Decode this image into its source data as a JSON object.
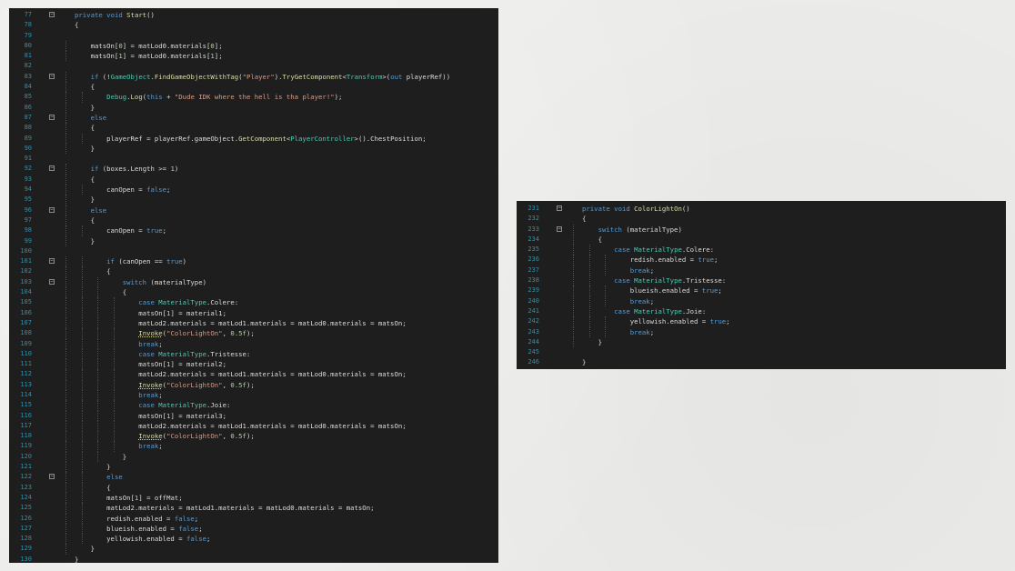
{
  "left_editor": {
    "lines": [
      {
        "n": "77",
        "code": "private void Start()",
        "fold": true
      },
      {
        "n": "78",
        "code": "{"
      },
      {
        "n": "79",
        "code": ""
      },
      {
        "n": "80",
        "code": "    matsOn[0] = matLod0.materials[0];"
      },
      {
        "n": "81",
        "code": "    matsOn[1] = matLod0.materials[1];"
      },
      {
        "n": "82",
        "code": ""
      },
      {
        "n": "83",
        "code": "    if (!GameObject.FindGameObjectWithTag(\"Player\").TryGetComponent<Transform>(out playerRef))",
        "fold": true
      },
      {
        "n": "84",
        "code": "    {"
      },
      {
        "n": "85",
        "code": "        Debug.Log(this + \"Dude IDK where the hell is tha player!\");"
      },
      {
        "n": "86",
        "code": "    }"
      },
      {
        "n": "87",
        "code": "    else",
        "fold": true
      },
      {
        "n": "88",
        "code": "    {"
      },
      {
        "n": "89",
        "code": "        playerRef = playerRef.gameObject.GetComponent<PlayerController>().ChestPosition;"
      },
      {
        "n": "90",
        "code": "    }"
      },
      {
        "n": "91",
        "code": ""
      },
      {
        "n": "92",
        "code": "    if (boxes.Length >= 1)",
        "fold": true
      },
      {
        "n": "93",
        "code": "    {"
      },
      {
        "n": "94",
        "code": "        canOpen = false;"
      },
      {
        "n": "95",
        "code": "    }"
      },
      {
        "n": "96",
        "code": "    else",
        "fold": true
      },
      {
        "n": "97",
        "code": "    {"
      },
      {
        "n": "98",
        "code": "        canOpen = true;"
      },
      {
        "n": "99",
        "code": "    }"
      },
      {
        "n": "100",
        "code": ""
      },
      {
        "n": "101",
        "code": "        if (canOpen == true)",
        "fold": true
      },
      {
        "n": "102",
        "code": "        {"
      },
      {
        "n": "103",
        "code": "            switch (materialType)",
        "fold": true
      },
      {
        "n": "104",
        "code": "            {"
      },
      {
        "n": "105",
        "code": "                case MaterialType.Colere:"
      },
      {
        "n": "106",
        "code": "                matsOn[1] = material1;"
      },
      {
        "n": "107",
        "code": "                matLod2.materials = matLod1.materials = matLod0.materials = matsOn;"
      },
      {
        "n": "108",
        "code": "                Invoke(\"ColorLightOn\", 0.5f);"
      },
      {
        "n": "109",
        "code": "                break;"
      },
      {
        "n": "110",
        "code": "                case MaterialType.Tristesse:"
      },
      {
        "n": "111",
        "code": "                matsOn[1] = material2;"
      },
      {
        "n": "112",
        "code": "                matLod2.materials = matLod1.materials = matLod0.materials = matsOn;"
      },
      {
        "n": "113",
        "code": "                Invoke(\"ColorLightOn\", 0.5f);"
      },
      {
        "n": "114",
        "code": "                break;"
      },
      {
        "n": "115",
        "code": "                case MaterialType.Joie:"
      },
      {
        "n": "116",
        "code": "                matsOn[1] = material3;"
      },
      {
        "n": "117",
        "code": "                matLod2.materials = matLod1.materials = matLod0.materials = matsOn;"
      },
      {
        "n": "118",
        "code": "                Invoke(\"ColorLightOn\", 0.5f);"
      },
      {
        "n": "119",
        "code": "                break;"
      },
      {
        "n": "120",
        "code": "            }"
      },
      {
        "n": "121",
        "code": "        }"
      },
      {
        "n": "122",
        "code": "        else",
        "fold": true
      },
      {
        "n": "123",
        "code": "        {"
      },
      {
        "n": "124",
        "code": "        matsOn[1] = offMat;"
      },
      {
        "n": "125",
        "code": "        matLod2.materials = matLod1.materials = matLod0.materials = matsOn;"
      },
      {
        "n": "126",
        "code": "        redish.enabled = false;"
      },
      {
        "n": "127",
        "code": "        blueish.enabled = false;"
      },
      {
        "n": "128",
        "code": "        yellowish.enabled = false;"
      },
      {
        "n": "129",
        "code": "    }"
      },
      {
        "n": "130",
        "code": "}"
      }
    ]
  },
  "right_editor": {
    "lines": [
      {
        "n": "231",
        "code": "private void ColorLightOn()",
        "fold": true
      },
      {
        "n": "232",
        "code": "{"
      },
      {
        "n": "233",
        "code": "    switch (materialType)",
        "fold": true
      },
      {
        "n": "234",
        "code": "    {"
      },
      {
        "n": "235",
        "code": "        case MaterialType.Colere:"
      },
      {
        "n": "236",
        "code": "            redish.enabled = true;"
      },
      {
        "n": "237",
        "code": "            break;"
      },
      {
        "n": "238",
        "code": "        case MaterialType.Tristesse:"
      },
      {
        "n": "239",
        "code": "            blueish.enabled = true;"
      },
      {
        "n": "240",
        "code": "            break;"
      },
      {
        "n": "241",
        "code": "        case MaterialType.Joie:"
      },
      {
        "n": "242",
        "code": "            yellowish.enabled = true;"
      },
      {
        "n": "243",
        "code": "            break;"
      },
      {
        "n": "244",
        "code": "    }"
      },
      {
        "n": "245",
        "code": ""
      },
      {
        "n": "246",
        "code": "}"
      }
    ]
  },
  "colors": {
    "background": "#ececea",
    "editor_bg": "#1e1e1e",
    "line_number": "#2b91af",
    "keyword": "#569cd6",
    "type": "#4ec9b0",
    "method": "#dcdcaa",
    "string": "#d69d85",
    "number": "#b5cea8"
  }
}
